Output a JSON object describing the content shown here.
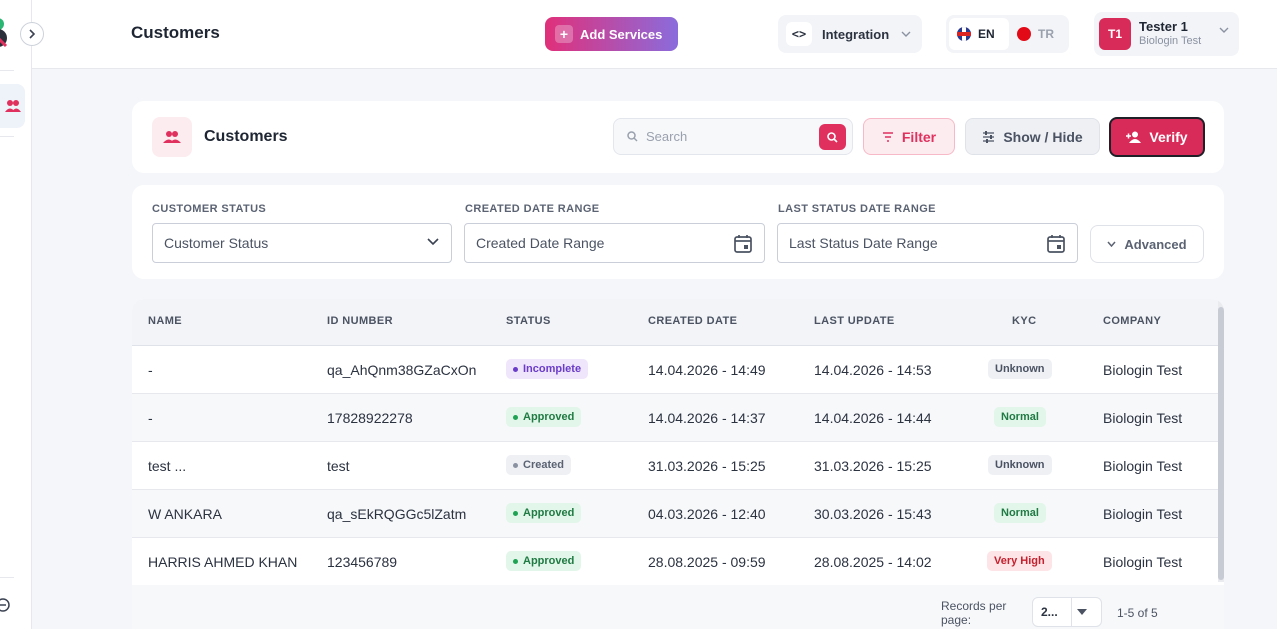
{
  "header": {
    "title": "Customers",
    "add_services": "Add Services",
    "integration": "Integration",
    "lang_en": "EN",
    "lang_tr": "TR",
    "user_initials": "T1",
    "user_name": "Tester 1",
    "user_company": "Biologin Test"
  },
  "toolbar": {
    "title": "Customers",
    "search_placeholder": "Search",
    "filter": "Filter",
    "show_hide": "Show / Hide",
    "verify": "Verify"
  },
  "filters": {
    "customer_status_label": "CUSTOMER STATUS",
    "customer_status_value": "Customer Status",
    "created_range_label": "CREATED DATE RANGE",
    "created_range_value": "Created Date Range",
    "last_status_label": "LAST STATUS DATE RANGE",
    "last_status_value": "Last Status Date Range",
    "advanced": "Advanced"
  },
  "table": {
    "columns": [
      "NAME",
      "ID NUMBER",
      "STATUS",
      "CREATED DATE",
      "LAST UPDATE",
      "KYC",
      "COMPANY"
    ],
    "rows": [
      {
        "name": "-",
        "id": "qa_AhQnm38GZaCxOn",
        "status": "Incomplete",
        "created": "14.04.2026 - 14:49",
        "updated": "14.04.2026 - 14:53",
        "kyc": "Unknown",
        "company": "Biologin Test"
      },
      {
        "name": "-",
        "id": "17828922278",
        "status": "Approved",
        "created": "14.04.2026 - 14:37",
        "updated": "14.04.2026 - 14:44",
        "kyc": "Normal",
        "company": "Biologin Test"
      },
      {
        "name": "test ...",
        "id": "test",
        "status": "Created",
        "created": "31.03.2026 - 15:25",
        "updated": "31.03.2026 - 15:25",
        "kyc": "Unknown",
        "company": "Biologin Test"
      },
      {
        "name": "W ANKARA",
        "id": "qa_sEkRQGGc5lZatm",
        "status": "Approved",
        "created": "04.03.2026 - 12:40",
        "updated": "30.03.2026 - 15:43",
        "kyc": "Normal",
        "company": "Biologin Test"
      },
      {
        "name": "HARRIS AHMED KHAN",
        "id": "123456789",
        "status": "Approved",
        "created": "28.08.2025 - 09:59",
        "updated": "28.08.2025 - 14:02",
        "kyc": "Very High",
        "company": "Biologin Test"
      }
    ]
  },
  "pagination": {
    "records_label": "Records per page:",
    "per_page": "2...",
    "range": "1-5 of 5"
  },
  "colors": {
    "primary": "#d92b5a",
    "gradient_start": "#e0307a",
    "gradient_end": "#8a6cdc"
  }
}
